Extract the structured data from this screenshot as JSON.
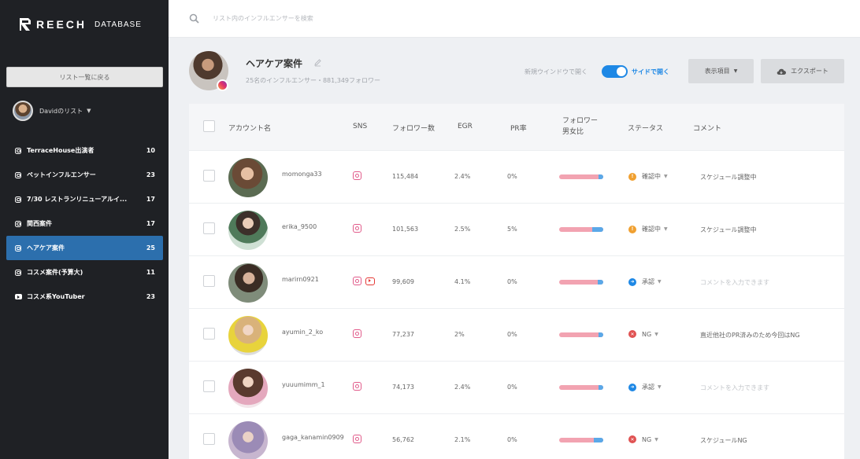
{
  "brand": {
    "name": "REECH",
    "sub": "DATABASE"
  },
  "sidebar": {
    "back_label": "リスト一覧に戻る",
    "user_label": "Davidのリスト",
    "items": [
      {
        "label": "TerraceHouse出演者",
        "count": "10",
        "icon": "instagram-icon",
        "active": false
      },
      {
        "label": "ペットインフルエンサー",
        "count": "23",
        "icon": "instagram-icon",
        "active": false
      },
      {
        "label": "7/30 レストランリニューアルイ...",
        "count": "17",
        "icon": "instagram-icon",
        "active": false
      },
      {
        "label": "関西案件",
        "count": "17",
        "icon": "instagram-icon",
        "active": false
      },
      {
        "label": "ヘアケア案件",
        "count": "25",
        "icon": "instagram-icon",
        "active": true
      },
      {
        "label": "コスメ案件(予算大)",
        "count": "11",
        "icon": "instagram-icon",
        "active": false
      },
      {
        "label": "コスメ系YouTuber",
        "count": "23",
        "icon": "youtube-icon",
        "active": false
      }
    ]
  },
  "search": {
    "placeholder": "リスト内のインフルエンサーを検索"
  },
  "header": {
    "title": "ヘアケア案件",
    "subtitle": "25名のインフルエンサー・881,349フォロワー",
    "new_window_label": "新規ウインドウで開く",
    "side_open_label": "サイドで開く",
    "display_items_label": "表示項目",
    "export_label": "エクスポート"
  },
  "table": {
    "columns": {
      "account": "アカウント名",
      "sns": "SNS",
      "followers": "フォロワー数",
      "egr": "EGR",
      "pr": "PR率",
      "gender_line1": "フォロワー",
      "gender_line2": "男女比",
      "status": "ステータス",
      "comment": "コメント"
    },
    "rows": [
      {
        "account": "momonga33",
        "sns": [
          "instagram"
        ],
        "followers": "115,484",
        "egr": "2.4%",
        "pr": "0%",
        "male_ratio": 0.1,
        "status": "確認中",
        "status_type": "pending",
        "comment": "スケジュール調整中",
        "comment_placeholder": false
      },
      {
        "account": "erika_9500",
        "sns": [
          "instagram"
        ],
        "followers": "101,563",
        "egr": "2.5%",
        "pr": "5%",
        "male_ratio": 0.25,
        "status": "確認中",
        "status_type": "pending",
        "comment": "スケジュール調整中",
        "comment_placeholder": false
      },
      {
        "account": "marirn0921",
        "sns": [
          "instagram",
          "youtube"
        ],
        "followers": "99,609",
        "egr": "4.1%",
        "pr": "0%",
        "male_ratio": 0.12,
        "status": "承認",
        "status_type": "approved",
        "comment": "コメントを入力できます",
        "comment_placeholder": true
      },
      {
        "account": "ayumin_2_ko",
        "sns": [
          "instagram"
        ],
        "followers": "77,237",
        "egr": "2%",
        "pr": "0%",
        "male_ratio": 0.1,
        "status": "NG",
        "status_type": "ng",
        "comment": "直近他社のPR済みのため今回はNG",
        "comment_placeholder": false
      },
      {
        "account": "yuuumimm_1",
        "sns": [
          "instagram"
        ],
        "followers": "74,173",
        "egr": "2.4%",
        "pr": "0%",
        "male_ratio": 0.1,
        "status": "承認",
        "status_type": "approved",
        "comment": "コメントを入力できます",
        "comment_placeholder": true
      },
      {
        "account": "gaga_kanamin0909",
        "sns": [
          "instagram"
        ],
        "followers": "56,762",
        "egr": "2.1%",
        "pr": "0%",
        "male_ratio": 0.22,
        "status": "NG",
        "status_type": "ng",
        "comment": "スケジュールNG",
        "comment_placeholder": false
      }
    ]
  },
  "colors": {
    "accent": "#1e88e5",
    "sidebar_bg": "#1f2125",
    "active_item": "#2c6fad",
    "pending": "#f0a030",
    "approved": "#1e88e5",
    "ng": "#e05252"
  }
}
